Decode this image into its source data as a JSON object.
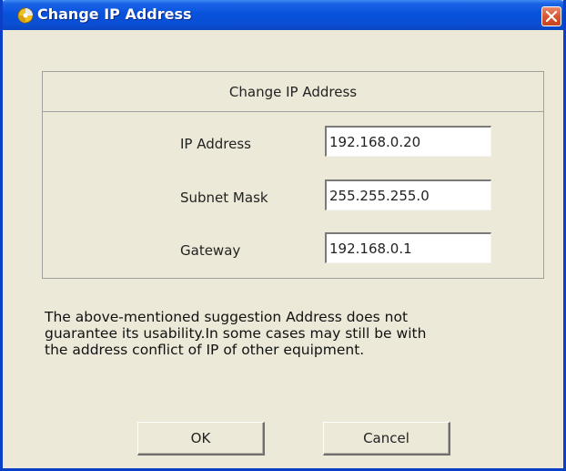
{
  "window": {
    "title": "Change IP Address",
    "title_icon": "app-swirl-icon",
    "close_icon": "close-icon",
    "colors": {
      "titlebar": "#0a4fd4",
      "close_button": "#d9572f",
      "dialog_background": "#ece9d8"
    }
  },
  "group": {
    "header": "Change IP Address",
    "fields": [
      {
        "label": "IP Address",
        "value": "192.168.0.20"
      },
      {
        "label": "Subnet Mask",
        "value": "255.255.255.0"
      },
      {
        "label": "Gateway",
        "value": "192.168.0.1"
      }
    ]
  },
  "notice": {
    "line1": "The above-mentioned suggestion Address does not",
    "line2": "guarantee its usability.In some cases may still be with",
    "line3": "the address conflict of IP of other equipment."
  },
  "buttons": {
    "ok": "OK",
    "cancel": "Cancel"
  }
}
